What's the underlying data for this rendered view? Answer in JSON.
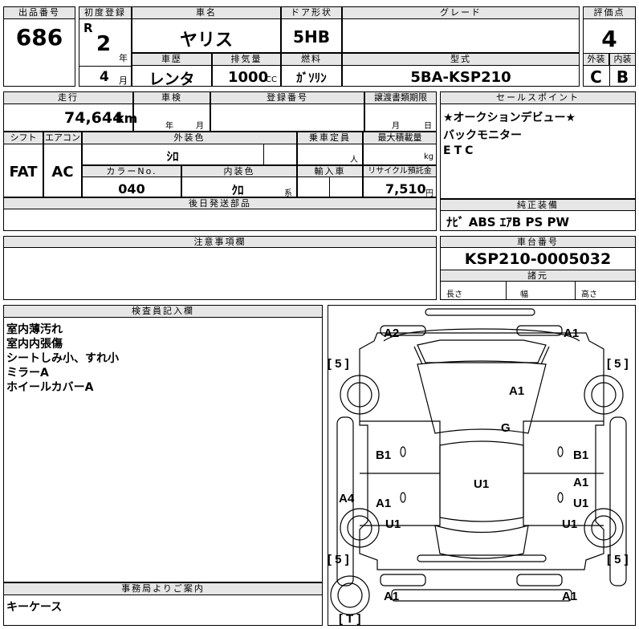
{
  "header": {
    "lot_label": "出品番号",
    "lot": "686",
    "first_reg_label": "初度登録",
    "era": "R",
    "year": "2",
    "year_unit": "年",
    "month": "4",
    "month_unit": "月",
    "name_label": "車名",
    "name": "ヤリス",
    "door_label": "ドア形状",
    "door": "5HB",
    "grade_label": "グレード",
    "grade": "",
    "score_label": "評価点",
    "score": "4",
    "history_label": "車歴",
    "history": "レンタ",
    "displacement_label": "排気量",
    "displacement": "1000",
    "cc": "CC",
    "fuel_label": "燃料",
    "fuel": "ｶﾞｿﾘﾝ",
    "model_label": "型式",
    "model": "5BA-KSP210",
    "ext_label": "外装",
    "ext": "C",
    "int_label": "内装",
    "int": "B"
  },
  "row2": {
    "mileage_label": "走行",
    "mileage": "74,644",
    "km": "km",
    "inspection_label": "車検",
    "insp_year": "年",
    "insp_month": "月",
    "reg_label": "登録番号",
    "transfer_label": "譲渡書類期限",
    "tr_month": "月",
    "tr_day": "日",
    "sales_label": "セールスポイント",
    "sales_points": [
      "★オークションデビュー★",
      "バックモニター",
      "ETC"
    ]
  },
  "row3": {
    "shift_label": "シフト",
    "shift": "FAT",
    "ac_label": "エアコン",
    "ac": "AC",
    "color_label": "外装色",
    "color": "ｼﾛ",
    "capacity_label": "乗車定員",
    "capacity_unit": "人",
    "load_label": "最大積載量",
    "load_unit": "kg",
    "color_no_label": "カラーNo.",
    "color_no": "040",
    "interior_color_label": "内装色",
    "interior_color": "ｸﾛ",
    "interior_color_unit": "系",
    "import_label": "輸入車",
    "recycle_label": "リサイクル預託金",
    "recycle": "7,510",
    "recycle_unit": "円",
    "later_label": "後日発送部品"
  },
  "equipment": {
    "label": "純正装備",
    "items": "ﾅﾋﾞ ABS ｴｱB PS PW"
  },
  "notes": {
    "label": "注意事項欄"
  },
  "chassis": {
    "label": "車台番号",
    "number": "KSP210-0005032",
    "spec_label": "諸元",
    "length": "長さ",
    "width": "幅",
    "height": "高さ"
  },
  "inspector": {
    "label": "検査員記入欄",
    "lines": [
      "室内薄汚れ",
      "室内内張傷",
      "シートしみ小、すれ小",
      "ミラーA",
      "ホイールカバーA"
    ]
  },
  "office": {
    "label": "事務局よりご案内",
    "text": "キーケース"
  },
  "diagram": {
    "marks": {
      "a2": "A2",
      "a1_fr": "A1",
      "tl5": "[ 5 ]",
      "tr5": "[ 5 ]",
      "hood": "A1",
      "roof_g": "G",
      "b1_l": "B1",
      "b1_r": "B1",
      "u1_c": "U1",
      "a1_r1": "A1",
      "a1_l": "A1",
      "u1_r2": "U1",
      "a4": "A4",
      "u1_l": "U1",
      "u1_r": "U1",
      "bl5": "[ 5 ]",
      "br5": "[ 5 ]",
      "a1_bl": "A1",
      "a1_br": "A1",
      "t": "[ T ]"
    }
  }
}
